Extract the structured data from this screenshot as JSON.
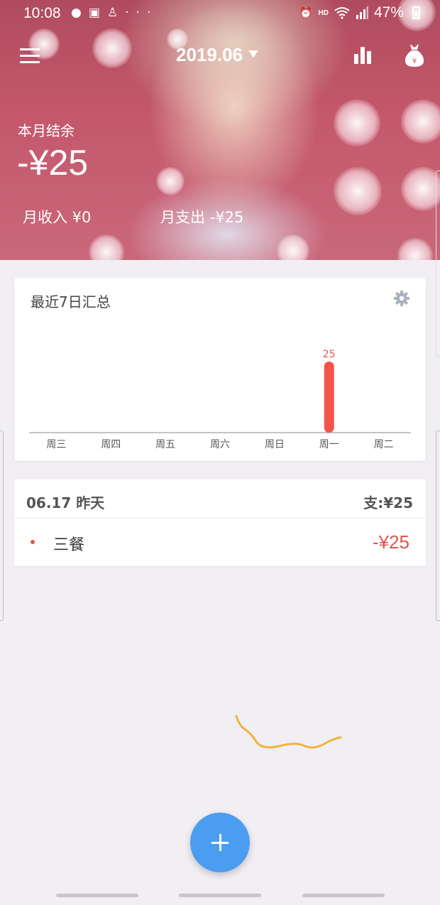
{
  "status_bar": {
    "time": "10:08",
    "left_icons": [
      "mic-icon",
      "image-icon",
      "person-icon",
      "more-icon"
    ],
    "more": "···",
    "right_icons": [
      "alarm-icon",
      "hd-icon",
      "wifi-icon",
      "signal-icon"
    ],
    "hd": "HD",
    "battery_pct": "47%"
  },
  "header": {
    "month": "2019.06",
    "balance_label": "本月结余",
    "balance_value": "-¥25",
    "income": "月收入 ¥0",
    "expense": "月支出 -¥25"
  },
  "summary": {
    "title": "最近7日汇总"
  },
  "chart_data": {
    "type": "bar",
    "categories": [
      "周三",
      "周四",
      "周五",
      "周六",
      "周日",
      "周一",
      "周二"
    ],
    "values": [
      0,
      0,
      0,
      0,
      0,
      25,
      0
    ],
    "data_labels": [
      "",
      "",
      "",
      "",
      "",
      "25",
      ""
    ],
    "title": "最近7日汇总",
    "xlabel": "",
    "ylabel": "",
    "ylim": [
      0,
      30
    ],
    "grid": false,
    "bar_color": "#f4534a"
  },
  "day_group": {
    "date": "06.17 昨天",
    "total": "支:¥25",
    "entries": [
      {
        "name": "三餐",
        "amount": "-¥25"
      }
    ]
  },
  "colors": {
    "accent_blue": "#4a9df0",
    "expense_red": "#e0574f",
    "header_pink": "#c4586c"
  }
}
